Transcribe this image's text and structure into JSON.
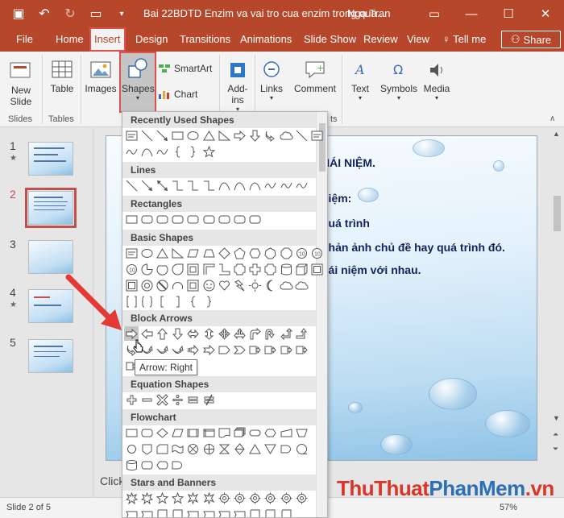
{
  "titlebar": {
    "doc_title": "Bai 22BDTD Enzim va vai tro cua enzim trong qua...",
    "user": "Nga Tran"
  },
  "tabs": [
    "File",
    "Home",
    "Insert",
    "Design",
    "Transitions",
    "Animations",
    "Slide Show",
    "Review",
    "View",
    "Tell me",
    "Share"
  ],
  "active_tab": "Insert",
  "ribbon": {
    "new_slide": "New Slide",
    "table": "Table",
    "images": "Images",
    "shapes": "Shapes",
    "smartart": "SmartArt",
    "chart": "Chart",
    "addins": "Add-ins",
    "links": "Links",
    "comment": "Comment",
    "text": "Text",
    "symbols": "Symbols",
    "media": "Media",
    "group_slides": "Slides",
    "group_tables": "Tables",
    "group_partial": "ts"
  },
  "thumbnails": [
    {
      "num": "1",
      "star": "★"
    },
    {
      "num": "2",
      "star": ""
    },
    {
      "num": "3",
      "star": ""
    },
    {
      "num": "4",
      "star": "★"
    },
    {
      "num": "5",
      "star": ""
    }
  ],
  "selected_slide": 2,
  "slide_lines": [
    "HÁI NIỆM.",
    "niệm:",
    "quá trình",
    "phản ảnh chủ đề hay quá trình đó.",
    "hái niệm với nhau."
  ],
  "notes_placeholder": "Click",
  "gallery": {
    "categories": [
      "Recently Used Shapes",
      "Lines",
      "Rectangles",
      "Basic Shapes",
      "Block Arrows",
      "Equation Shapes",
      "Flowchart",
      "Stars and Banners"
    ],
    "tooltip": "Arrow: Right"
  },
  "status": {
    "slide_info": "Slide 2 of 5",
    "zoom": "57%"
  },
  "watermark": {
    "part1": "ThuThuat",
    "part2": "PhanMem",
    "part3": ".vn"
  },
  "colors": {
    "accent": "#b7472a",
    "highlight": "#e05050"
  }
}
